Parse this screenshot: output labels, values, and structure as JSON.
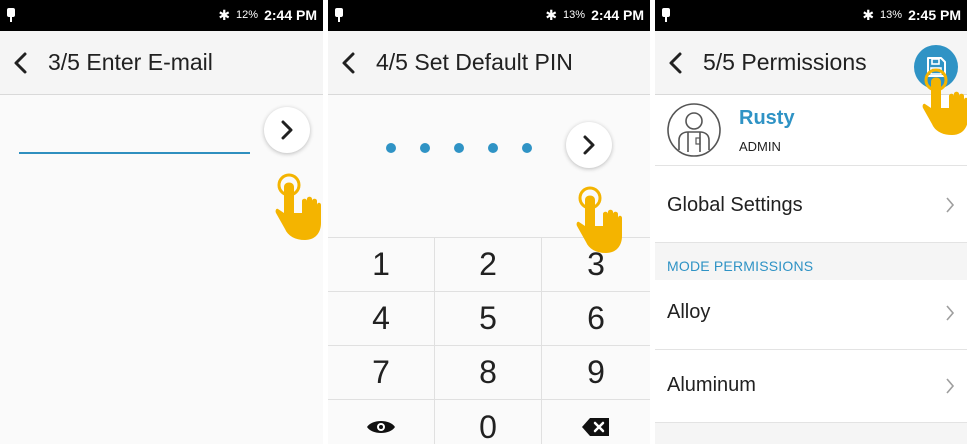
{
  "colors": {
    "accent": "#2f93c5",
    "statusbar": "#000000",
    "tap_indicator": "#f4b400"
  },
  "icons": {
    "back": "chevron-left-icon",
    "next": "chevron-right-icon",
    "save": "floppy-disk-icon",
    "reveal": "eye-icon",
    "delete": "backspace-icon",
    "bluetooth": "bluetooth-icon",
    "notification": "notification-icon",
    "tap": "tap-hand-icon",
    "avatar": "user-avatar-icon",
    "row_chevron": "chevron-right-icon"
  },
  "screen1": {
    "status": {
      "battery": "12%",
      "time": "2:44 PM"
    },
    "title": "3/5 Enter E-mail",
    "email_value": ""
  },
  "screen2": {
    "status": {
      "battery": "13%",
      "time": "2:44 PM"
    },
    "title": "4/5 Set Default PIN",
    "pin_length": 5,
    "keypad": {
      "k1": "1",
      "k2": "2",
      "k3": "3",
      "k4": "4",
      "k5": "5",
      "k6": "6",
      "k7": "7",
      "k8": "8",
      "k9": "9",
      "k0": "0"
    }
  },
  "screen3": {
    "status": {
      "battery": "13%",
      "time": "2:45 PM"
    },
    "title": "5/5 Permissions",
    "user": {
      "name": "Rusty",
      "role": "ADMIN"
    },
    "global_settings": "Global Settings",
    "section_header": "MODE PERMISSIONS",
    "modes": {
      "alloy": "Alloy",
      "aluminum": "Aluminum"
    }
  }
}
